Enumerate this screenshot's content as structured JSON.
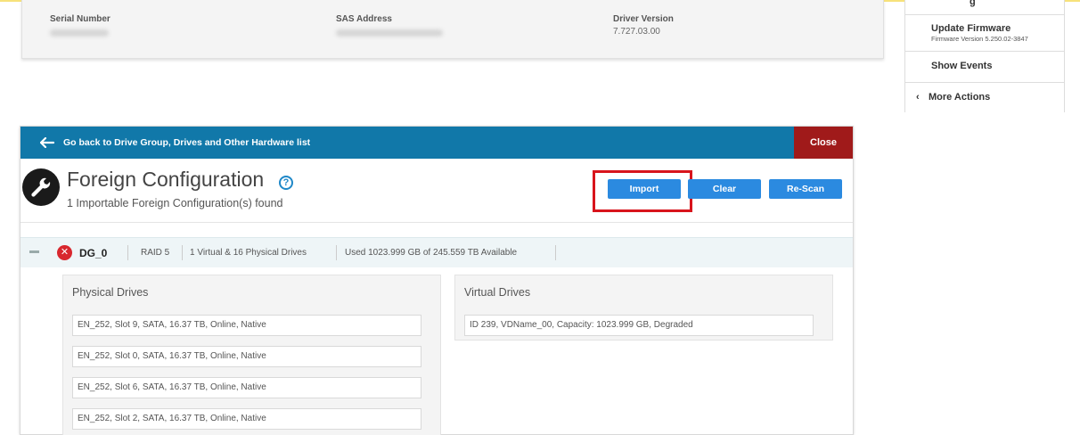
{
  "info": {
    "serial_label": "Serial Number",
    "sas_label": "SAS Address",
    "driver_label": "Driver Version",
    "driver_value": "7.727.03.00"
  },
  "side_menu": {
    "update_firmware": "Update Firmware",
    "firmware_version": "Firmware Version 5.250.02-3847",
    "show_events": "Show Events",
    "more_actions": "More Actions"
  },
  "panel": {
    "back_link": "Go back to Drive Group, Drives and Other Hardware list",
    "close": "Close",
    "title": "Foreign Configuration",
    "subtitle": "1 Importable Foreign Configuration(s) found",
    "buttons": {
      "import": "Import",
      "clear": "Clear",
      "rescan": "Re-Scan"
    }
  },
  "drive_group": {
    "name": "DG_0",
    "raid": "RAID 5",
    "drives": "1 Virtual & 16 Physical Drives",
    "usage": "Used 1023.999 GB of 245.559 TB Available"
  },
  "physical_drives": {
    "title": "Physical Drives",
    "items": [
      "EN_252, Slot 9, SATA, 16.37 TB, Online, Native",
      "EN_252, Slot 0, SATA, 16.37 TB, Online, Native",
      "EN_252, Slot 6, SATA, 16.37 TB, Online, Native",
      "EN_252, Slot 2, SATA, 16.37 TB, Online, Native"
    ]
  },
  "virtual_drives": {
    "title": "Virtual Drives",
    "items": [
      "ID 239, VDName_00, Capacity: 1023.999 GB, Degraded"
    ]
  },
  "colors": {
    "header_bar": "#1178a9",
    "close_button": "#a01a1a",
    "action_button": "#2b8ae0",
    "highlight": "#d8141c",
    "error": "#d8272e"
  }
}
